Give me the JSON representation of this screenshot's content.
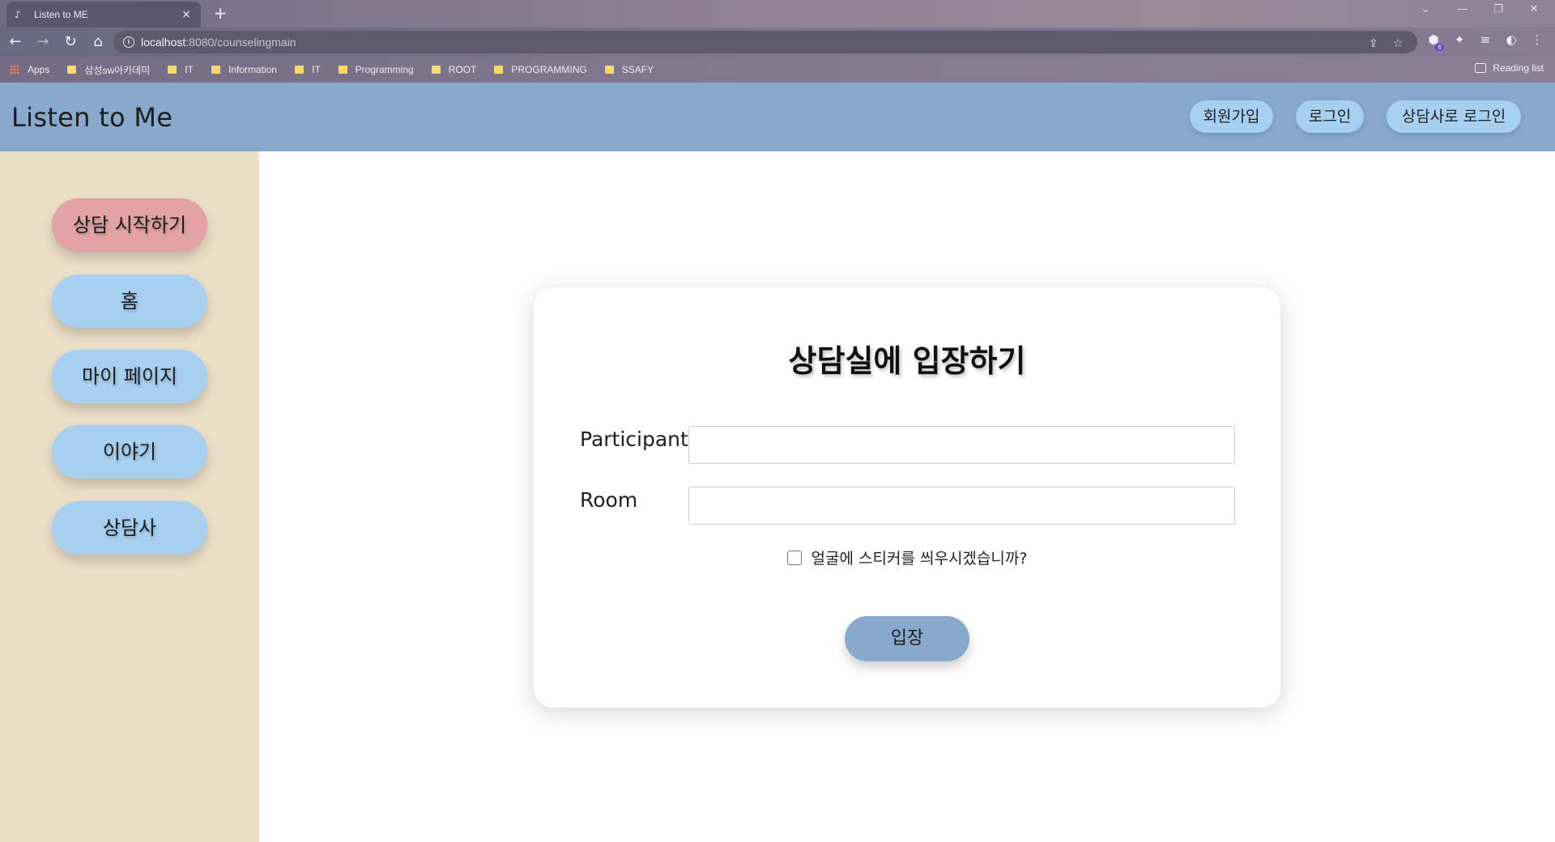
{
  "browser": {
    "tab_title": "Listen to ME",
    "tab_close": "×",
    "new_tab": "+",
    "url_host": "localhost",
    "url_rest": ":8080/counselingmain",
    "reading_list": "Reading list",
    "extension_badge": "6",
    "bookmarks": [
      "Apps",
      "삼성sw아카데미",
      "IT",
      "Information",
      "IT",
      "Programming",
      "ROOT",
      "PROGRAMMING",
      "SSAFY"
    ]
  },
  "header": {
    "brand": "Listen to Me",
    "signup": "회원가입",
    "login": "로그인",
    "counselor_login": "상담사로 로그인"
  },
  "sidebar": {
    "items": [
      {
        "label": "상담 시작하기"
      },
      {
        "label": "홈"
      },
      {
        "label": "마이 페이지"
      },
      {
        "label": "이야기"
      },
      {
        "label": "상담사"
      }
    ]
  },
  "form": {
    "title": "상담실에 입장하기",
    "participant_label": "Participant",
    "participant_value": "",
    "room_label": "Room",
    "room_value": "",
    "sticker_label": "얼굴에 스티커를 씌우시겠습니까?",
    "sticker_checked": false,
    "submit": "입장"
  },
  "colors": {
    "header": "#88a9cc",
    "sidebar": "#ebdfc8",
    "nav_button": "#a7cff0",
    "start_button": "#e3a3a4"
  }
}
